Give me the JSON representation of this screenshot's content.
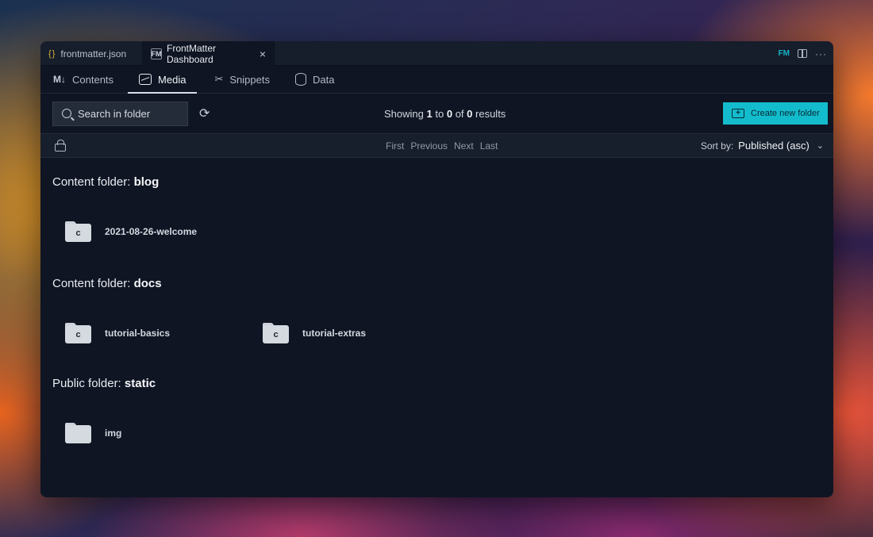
{
  "tabs": [
    {
      "icon": "{ }",
      "label": "frontmatter.json"
    },
    {
      "icon": "FM",
      "label": "FrontMatter Dashboard",
      "close": "×"
    }
  ],
  "strip_actions": {
    "fm_badge": "FM",
    "more": "···"
  },
  "nav": [
    {
      "icon": "M↓",
      "label": "Contents"
    },
    {
      "label": "Media"
    },
    {
      "icon": "✂",
      "label": "Snippets"
    },
    {
      "label": "Data"
    }
  ],
  "toolbar": {
    "search_placeholder": "Search in folder",
    "refresh_icon": "⟳",
    "results_prefix": "Showing",
    "results_from": "1",
    "results_to_word": "to",
    "results_to": "0",
    "results_of_word": "of",
    "results_total": "0",
    "results_suffix": "results",
    "create_label": "Create new folder",
    "create_icon": "+"
  },
  "pagination": {
    "first": "First",
    "previous": "Previous",
    "next": "Next",
    "last": "Last"
  },
  "sort": {
    "label": "Sort by:",
    "value": "Published (asc)",
    "chevron": "⌄"
  },
  "sections": [
    {
      "prefix": "Content folder:",
      "name": "blog",
      "folders": [
        {
          "letter": "c",
          "name": "2021-08-26-welcome"
        }
      ]
    },
    {
      "prefix": "Content folder:",
      "name": "docs",
      "folders": [
        {
          "letter": "c",
          "name": "tutorial-basics"
        },
        {
          "letter": "c",
          "name": "tutorial-extras"
        }
      ]
    },
    {
      "prefix": "Public folder:",
      "name": "static",
      "folders": [
        {
          "letter": "",
          "name": "img"
        }
      ]
    }
  ],
  "colors": {
    "accent": "#13bccd",
    "background": "#0f1523",
    "panel": "#181f2c"
  }
}
